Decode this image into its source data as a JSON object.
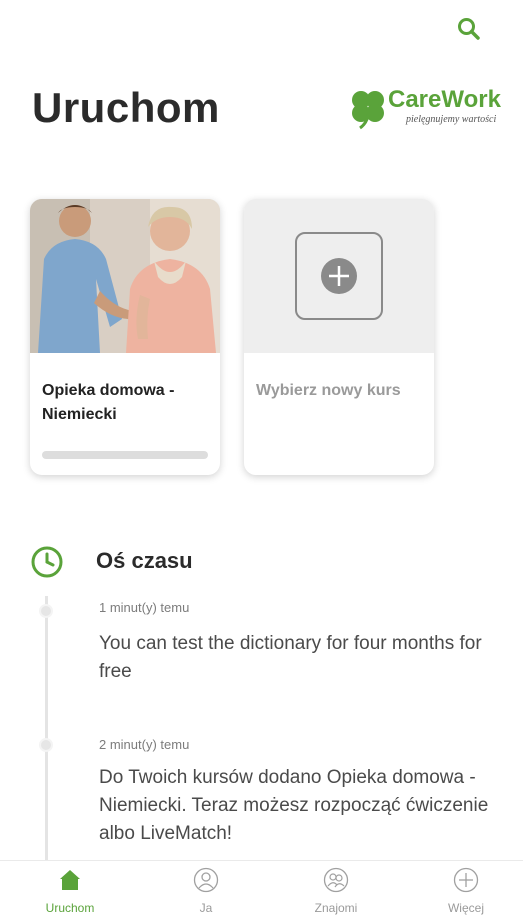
{
  "header": {
    "title": "Uruchom",
    "search_icon": "search-icon"
  },
  "brand": {
    "name": "CareWork",
    "tagline": "pielęgnujemy wartości",
    "color": "#5aa33a",
    "logo_icon": "clover-logo"
  },
  "courses": [
    {
      "title": "Opieka domowa - Niemiecki",
      "progress": 0.0,
      "image": "caregiver-with-senior-woman-photo"
    },
    {
      "title": "Wybierz nowy kurs",
      "icon": "plus-icon"
    }
  ],
  "timeline": {
    "title": "Oś czasu",
    "icon": "clock-icon",
    "entries": [
      {
        "time": "1 minut(y) temu",
        "text": "You can test the dictionary for four months for free"
      },
      {
        "time": "2 minut(y) temu",
        "text": "Do Twoich kursów dodano Opieka domowa - Niemiecki. Teraz możesz rozpocząć ćwiczenie albo LiveMatch!"
      }
    ]
  },
  "nav": {
    "items": [
      {
        "label": "Uruchom",
        "icon": "home-icon",
        "active": true
      },
      {
        "label": "Ja",
        "icon": "profile-icon",
        "active": false
      },
      {
        "label": "Znajomi",
        "icon": "friends-icon",
        "active": false
      },
      {
        "label": "Więcej",
        "icon": "plus-circle-icon",
        "active": false
      }
    ]
  },
  "colors": {
    "accent": "#5aa33a",
    "text": "#2b2b2b",
    "muted": "#9a9a9a"
  }
}
